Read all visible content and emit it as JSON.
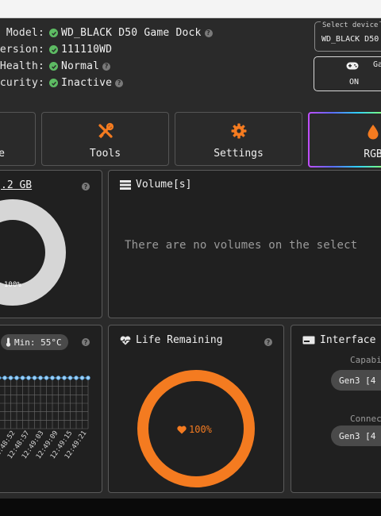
{
  "device_info": {
    "model_label": "Model:",
    "model_value": "WD_BLACK D50 Game Dock",
    "version_label": "ersion:",
    "version_value": "111110WD",
    "health_label": "Health:",
    "health_value": "Normal",
    "security_label": "curity:",
    "security_value": "Inactive"
  },
  "select_device": {
    "legend": "Select device",
    "value": "WD_BLACK D50"
  },
  "game_mode": {
    "label": "Ga",
    "state": "ON"
  },
  "tabs": [
    {
      "label": "e"
    },
    {
      "label": "Tools"
    },
    {
      "label": "Settings"
    },
    {
      "label": "RGB"
    }
  ],
  "capacity": {
    "title": ".2 GB",
    "percent_label": "100%",
    "used_fraction": 1.0
  },
  "volumes": {
    "title": "Volume[s]",
    "empty_message": "There are no volumes on the select"
  },
  "temperature": {
    "min_label": "Min: 55°C",
    "time_labels": [
      "46",
      "12:48:52",
      "12:48:57",
      "12:49:03",
      "12:49:09",
      "12:49:15",
      "12:49:21"
    ]
  },
  "life": {
    "title": "Life Remaining",
    "value_label": "100%",
    "fraction": 1.0
  },
  "interface": {
    "title": "Interface",
    "capability_label": "Capabi",
    "capability_value": "Gen3 [4",
    "connected_label": "Connec",
    "connected_value": "Gen3 [4"
  },
  "colors": {
    "accent": "#f47b20",
    "ok_green": "#5dbb63",
    "ring_grey": "#d6d6d6",
    "chart_point": "#5aa9e6"
  }
}
